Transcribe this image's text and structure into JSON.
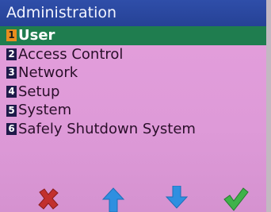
{
  "window": {
    "title": "Administration"
  },
  "menu": {
    "items": [
      {
        "number": "1",
        "label": "User",
        "selected": true
      },
      {
        "number": "2",
        "label": "Access Control",
        "selected": false
      },
      {
        "number": "3",
        "label": "Network",
        "selected": false
      },
      {
        "number": "4",
        "label": "Setup",
        "selected": false
      },
      {
        "number": "5",
        "label": "System",
        "selected": false
      },
      {
        "number": "6",
        "label": "Safely Shutdown System",
        "selected": false
      }
    ]
  },
  "softkeys": [
    {
      "icon": "cancel-x-icon",
      "color": "#c2302e"
    },
    {
      "icon": "arrow-up-icon",
      "color": "#2f8fe0"
    },
    {
      "icon": "arrow-down-icon",
      "color": "#2f8fe0"
    },
    {
      "icon": "confirm-check-icon",
      "color": "#3fb24a"
    }
  ],
  "colors": {
    "title_bar": "#2f4ea9",
    "background": "#e49fdc",
    "selection": "#1f7d4f",
    "selected_number_badge": "#e88d1e",
    "number_badge": "#1f1a4a"
  }
}
